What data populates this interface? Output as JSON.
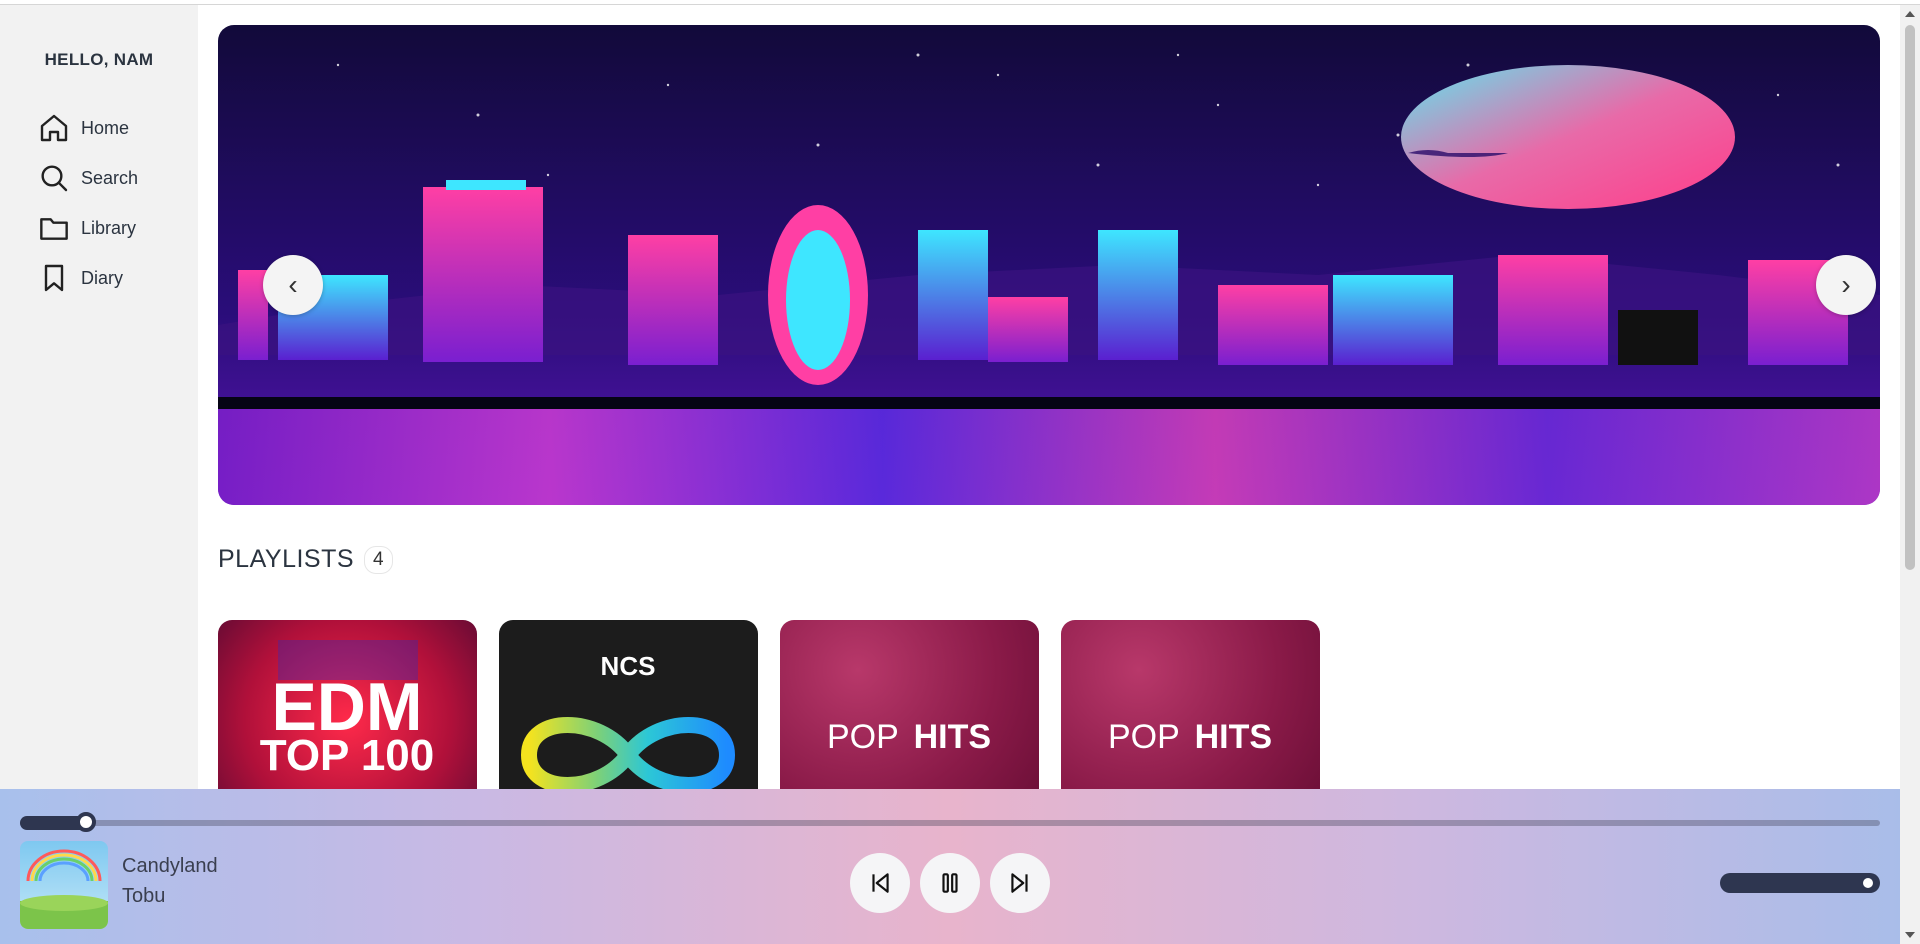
{
  "sidebar": {
    "greeting": "HELLO, NAM",
    "items": [
      {
        "label": "Home",
        "icon": "home-icon"
      },
      {
        "label": "Search",
        "icon": "search-icon"
      },
      {
        "label": "Library",
        "icon": "folder-icon"
      },
      {
        "label": "Diary",
        "icon": "bookmark-icon"
      }
    ]
  },
  "banner": {
    "prev_symbol": "‹",
    "next_symbol": "›"
  },
  "playlists": {
    "title": "PLAYLISTS",
    "count": "4",
    "cards": [
      {
        "line1": "EDM",
        "line2": "TOP 100"
      },
      {
        "logo": "NCS"
      },
      {
        "light": "POP",
        "bold": "HITS"
      },
      {
        "light": "POP",
        "bold": "HITS"
      }
    ]
  },
  "player": {
    "song": "Candyland",
    "artist": "Tobu",
    "progress": 0.04,
    "volume": 1.0,
    "colors": {
      "accent": "#2e3650"
    }
  }
}
